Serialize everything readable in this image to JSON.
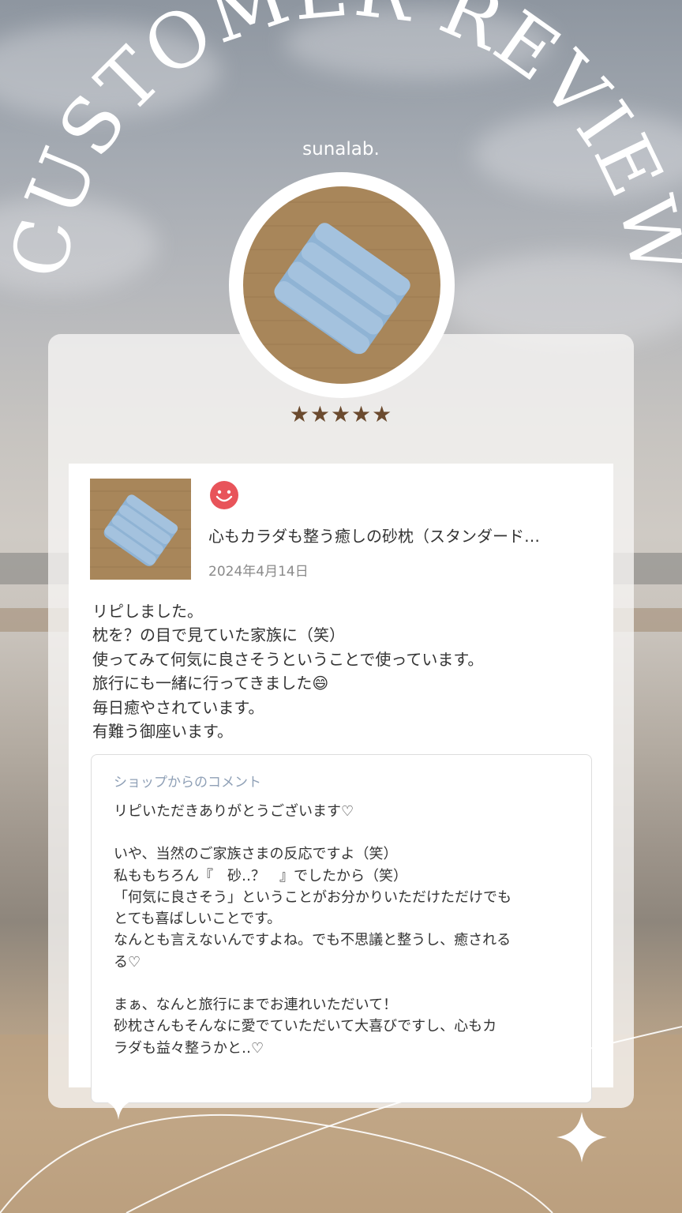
{
  "header": {
    "title": "CUSTOMER REVIEW",
    "brand": "sunalab."
  },
  "rating": {
    "stars_text": "★★★★★",
    "value": 5,
    "max": 5
  },
  "review": {
    "product_title": "心もカラダも整う癒しの砂枕（スタンダード…",
    "date": "2024年4月14日",
    "lines": [
      "リピしました。",
      "枕を？の目で見ていた家族に（笑）",
      "使ってみて何気に良さそうということで使っています。",
      "旅行にも一緒に行ってきました😄",
      "毎日癒やされています。",
      "有難う御座います。"
    ]
  },
  "shop_comment": {
    "label": "ショップからのコメント",
    "lines": [
      "リピいただきありがとうございます♡",
      "",
      "いや、当然のご家族さまの反応ですよ（笑）",
      "私ももちろん『　砂‥？　』でしたから（笑）",
      "「何気に良さそう」ということがお分かりいただけただけでも",
      "とても喜ばしいことです。",
      "なんとも言えないんですよね。でも不思議と整うし、癒される",
      "る♡",
      "",
      "まぁ、なんと旅行にまでお連れいただいて！",
      "砂枕さんもそんなに愛でていただいて大喜びですし、心もカ",
      "ラダも益々整うかと‥♡"
    ]
  },
  "colors": {
    "star": "#6b4a2e",
    "smiley": "#e8545a",
    "pillow": "#8fb3d4",
    "burlap": "#a8865a",
    "shop_label": "#8fa0b6"
  },
  "icons": {
    "smiley": "smiley-face-icon",
    "sparkle": "sparkle-icon"
  }
}
